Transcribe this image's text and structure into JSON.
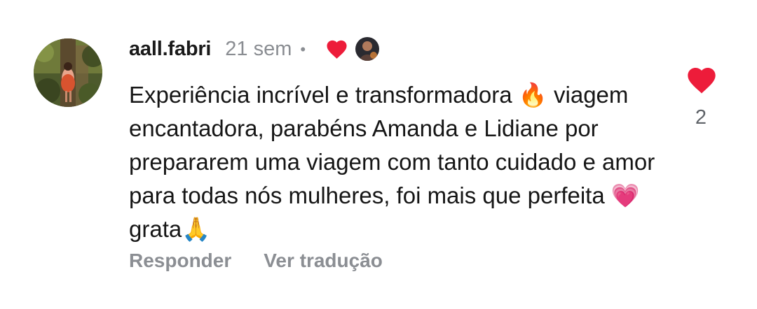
{
  "comment": {
    "username": "aall.fabri",
    "time_ago": "21 sem",
    "separator": "•",
    "text": "Experiência incrível e transformadora 🔥 viagem encantadora, parabéns Amanda e Lidiane por prepararem uma viagem com tanto cuidado e amor para todas nós mulheres, foi mais que perfeita 💗grata🙏",
    "actions": {
      "reply_label": "Responder",
      "translate_label": "Ver tradução"
    },
    "likes": {
      "count": "2"
    }
  },
  "icons": {
    "like": "heart-icon",
    "author_like": "heart-icon",
    "avatar": "user-avatar"
  },
  "colors": {
    "heart": "#ed1c3a",
    "muted_text": "#8a8d92",
    "body_text": "#161616"
  }
}
